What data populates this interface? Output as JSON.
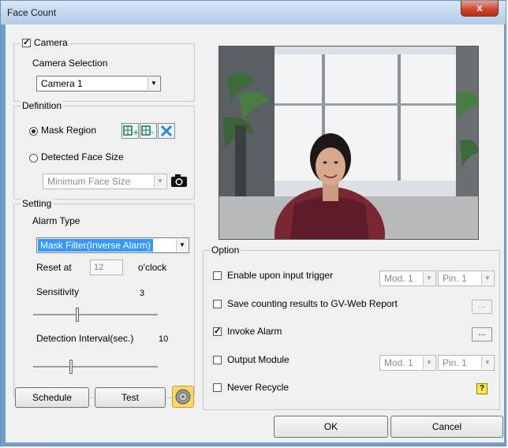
{
  "window": {
    "title": "Face Count",
    "close_label": "x"
  },
  "camera": {
    "checkbox_label": "Camera",
    "checked": true,
    "selection_label": "Camera Selection",
    "selected": "Camera 1"
  },
  "definition": {
    "legend": "Definition",
    "mask_region_label": "Mask Region",
    "detected_face_label": "Detected Face Size",
    "face_size_value": "Minimum Face Size",
    "mask_region_selected": true
  },
  "setting": {
    "legend": "Setting",
    "alarm_type_label": "Alarm Type",
    "alarm_type_value": "Mask Filter(Inverse Alarm)",
    "reset_at_label": "Reset at",
    "reset_at_value": "12",
    "oclock_label": "o'clock",
    "sensitivity_label": "Sensitivity",
    "sensitivity_value": "3",
    "sensitivity_level": 0.35,
    "detection_interval_label": "Detection Interval(sec.)",
    "detection_interval_value": "10",
    "detection_interval_level": 0.3
  },
  "buttons": {
    "schedule": "Schedule",
    "test": "Test",
    "ok": "OK",
    "cancel": "Cancel"
  },
  "option": {
    "legend": "Option",
    "enable_trigger_label": "Enable upon input trigger",
    "enable_trigger_module": "Mod. 1",
    "enable_trigger_pin": "Pin. 1",
    "save_counting_label": "Save counting results to GV-Web Report",
    "invoke_alarm_label": "Invoke Alarm",
    "invoke_alarm_checked": true,
    "output_module_label": "Output Module",
    "output_module_module": "Mod. 1",
    "output_module_pin": "Pin. 1",
    "never_recycle_label": "Never Recycle",
    "ellipsis": "..."
  },
  "colors": {
    "selection": "#3399ff",
    "title_bar": "#c2d8ee",
    "close_button": "#c9442a"
  }
}
